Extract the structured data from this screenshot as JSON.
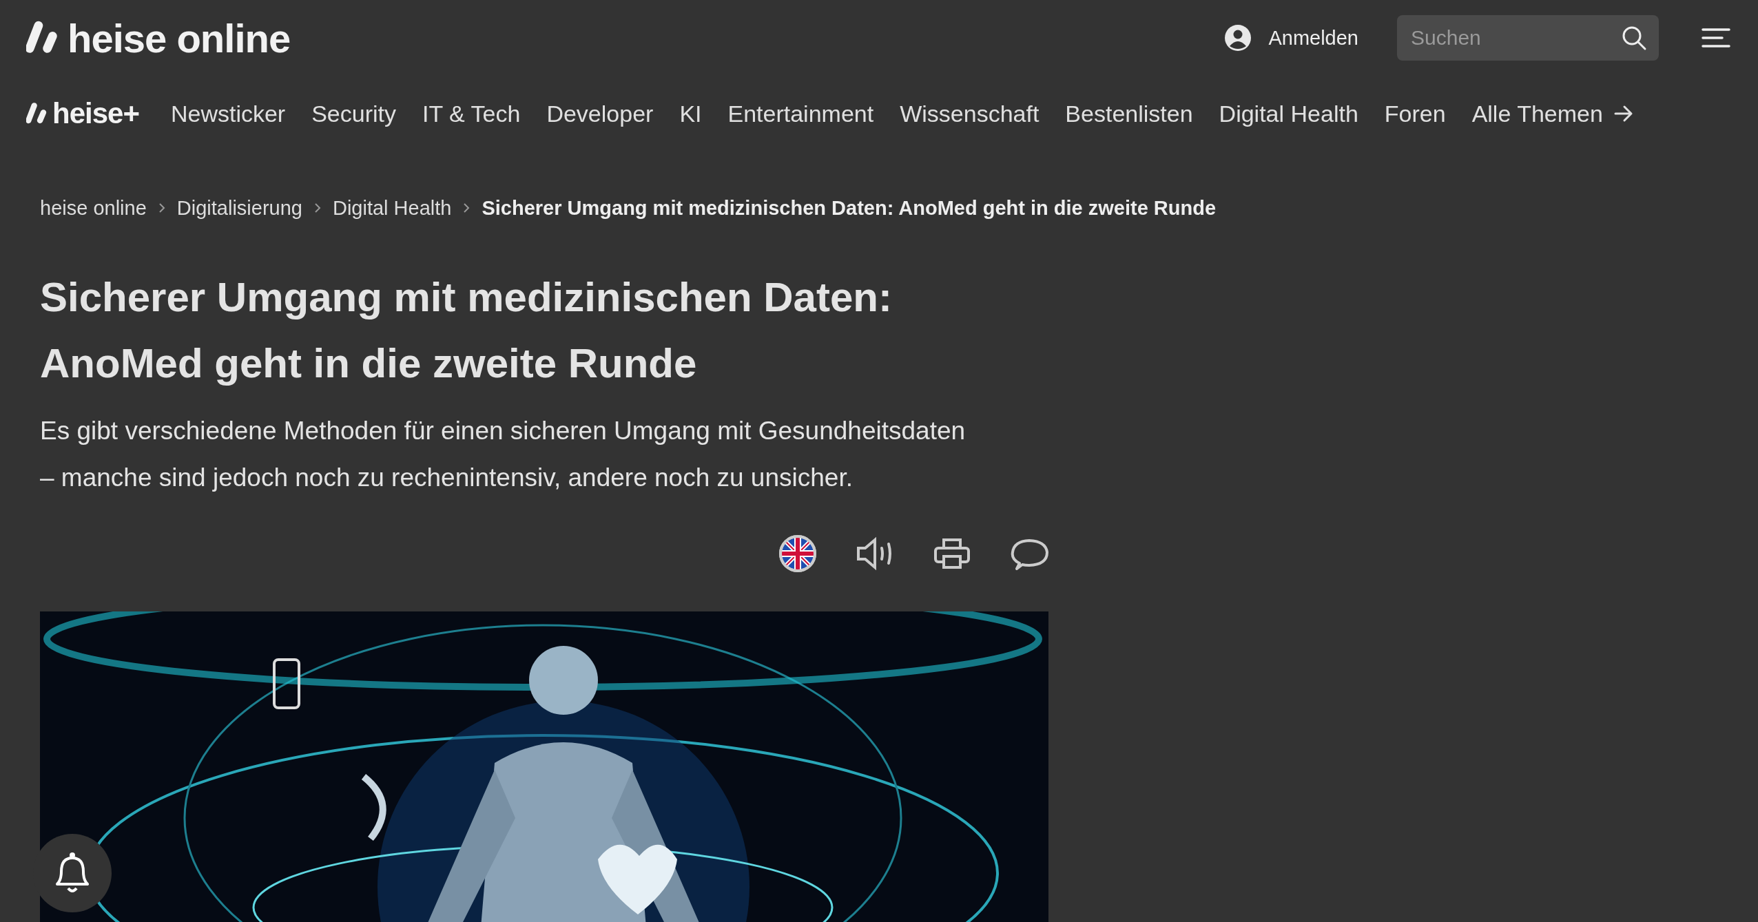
{
  "header": {
    "logo": "heise online",
    "login": "Anmelden",
    "search": {
      "placeholder": "Suchen"
    }
  },
  "nav": {
    "logo": "heise+",
    "items": [
      "Newsticker",
      "Security",
      "IT & Tech",
      "Developer",
      "KI",
      "Entertainment",
      "Wissenschaft",
      "Bestenlisten",
      "Digital Health",
      "Foren"
    ],
    "more": "Alle Themen"
  },
  "breadcrumb": [
    {
      "label": "heise online",
      "current": false
    },
    {
      "label": "Digitalisierung",
      "current": false
    },
    {
      "label": "Digital Health",
      "current": false
    },
    {
      "label": "Sicherer Umgang mit medizinischen Daten: AnoMed geht in die zweite Runde",
      "current": true
    }
  ],
  "article": {
    "title": "Sicherer Umgang mit medizinischen Daten: AnoMed geht in die zweite Runde",
    "lead": "Es gibt verschiedene Methoden für einen sicheren Umgang mit Gesundheitsdaten – manche sind jedoch noch zu rechenintensiv, andere noch zu unsicher.",
    "tools": [
      {
        "kind": "translate"
      },
      {
        "kind": "audio"
      },
      {
        "kind": "print"
      },
      {
        "kind": "comments"
      }
    ]
  }
}
